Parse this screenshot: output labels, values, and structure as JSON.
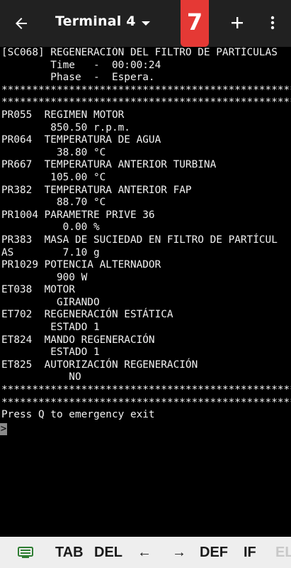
{
  "appbar": {
    "title": "Terminal 4",
    "session_number": "7",
    "icons": {
      "back": "arrow-back-icon",
      "dropdown": "dropdown-triangle-icon",
      "add": "plus-icon",
      "menu": "more-vert-icon"
    },
    "colors": {
      "bar": "#212121",
      "badge": "#e53935"
    }
  },
  "terminal": {
    "lines": [
      "[SC068] REGENERACIÓN DEL FILTRO DE PARTÍCULAS",
      "        Time   -  00:00:24",
      "        Phase  -  Espera.",
      "*************************************************",
      "*************************************************",
      "PR055  REGIMEN MOTOR",
      "        850.50 r.p.m.",
      "PR064  TEMPERATURA DE AGUA",
      "         38.80 °C",
      "PR667  TEMPERATURA ANTERIOR TURBINA",
      "        105.00 °C",
      "PR382  TEMPERATURA ANTERIOR FAP",
      "         88.70 °C",
      "PR1004 PARAMETRE PRIVE 36",
      "          0.00 %",
      "PR383  MASA DE SUCIEDAD EN FILTRO DE PARTÍCUL",
      "AS        7.10 g",
      "PR1029 POTENCIA ALTERNADOR",
      "         900 W",
      "ET038  MOTOR",
      "         GIRANDO",
      "ET702  REGENERACIÓN ESTÁTICA",
      "        ESTADO 1",
      "ET824  MANDO REGENERACIÓN",
      "        ESTADO 1",
      "ET825  AUTORIZACIÓN REGENERACIÓN",
      "           NO",
      "*************************************************",
      "*************************************************",
      "Press Q to emergency exit"
    ],
    "cursor_char": ">",
    "colors": {
      "background": "#000000",
      "text": "#f2f2f2",
      "cursor": "#8a8a8a"
    }
  },
  "extra_keys": {
    "keyboard_icon": "keyboard-icon",
    "items": [
      "TAB",
      "DEL",
      "←",
      "→",
      "DEF",
      "IF",
      "EL"
    ],
    "colors": {
      "bar": "#eeeeee",
      "keyboard_icon": "#2e7d32"
    }
  }
}
